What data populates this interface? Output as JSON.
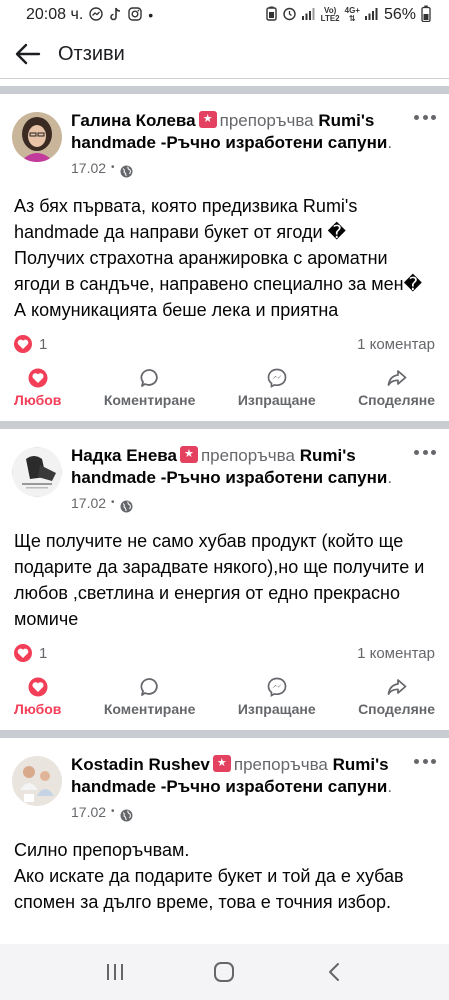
{
  "status": {
    "time": "20:08 ч.",
    "battery": "56%",
    "network_top": "Vo)",
    "network_bottom": "LTE2",
    "network_gen": "4G+"
  },
  "header": {
    "title": "Отзиви"
  },
  "posts": [
    {
      "author": "Галина Колева",
      "recommends": "препоръчва",
      "page": "Rumi's handmade -Ръчно изработени сапуни",
      "date": "17.02",
      "body": "Аз бях първата, която предизвика Rumi's handmade да направи букет от ягоди �\nПолучих страхотна аранжировка с ароматни ягоди в сандъче, направено специално за мен�\nА комуникацията беше лека и приятна",
      "likes": "1",
      "comments": "1 коментар"
    },
    {
      "author": "Надка Енева",
      "recommends": "препоръчва",
      "page": "Rumi's handmade -Ръчно изработени сапуни",
      "date": "17.02",
      "body": "Ще получите не само хубав продукт (който ще подарите да зарадвате някого),но ще получите и любов ,светлина и енергия от едно прекрасно момиче",
      "likes": "1",
      "comments": "1 коментар"
    },
    {
      "author": "Kostadin Rushev",
      "recommends": "препоръчва",
      "page": "Rumi's handmade -Ръчно изработени сапуни",
      "date": "17.02",
      "body": "Силно препоръчвам.\nАко искате да подарите букет и той да е хубав спомен за дълго време, това е точния избор."
    }
  ],
  "actions": {
    "love": "Любов",
    "comment": "Коментиране",
    "send": "Изпращане",
    "share": "Споделяне"
  },
  "colors": {
    "love_red": "#f33e58",
    "badge_pink": "#e4405f",
    "secondary_text": "#65676b",
    "divider": "#c9ccd1"
  },
  "icons": [
    "back-arrow-icon",
    "globe-icon",
    "more-icon",
    "heart-icon",
    "comment-icon",
    "messenger-icon",
    "share-icon",
    "recommend-badge-icon"
  ]
}
